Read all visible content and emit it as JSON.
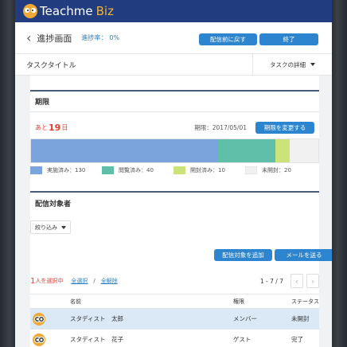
{
  "header": {
    "logo_main": "Teachme",
    "logo_biz": "Biz"
  },
  "topbar": {
    "back_icon": "chevron-left-icon",
    "title": "進捗画面",
    "progress_label": "進捗率：",
    "progress_value": "0%",
    "return_button": "配信前に戻す",
    "finish_button": "終了"
  },
  "task": {
    "title": "タスクタイトル",
    "detail_label": "タスクの詳細"
  },
  "deadline": {
    "heading": "期限",
    "remaining_prefix": "あと",
    "remaining_days": "19",
    "remaining_suffix": "日",
    "due_date": "期限：2017/05/01",
    "change_button": "期限を変更する",
    "chart_data": {
      "type": "bar",
      "orientation": "horizontal-stacked",
      "categories": [
        "実施済み",
        "閲覧済み",
        "開封済み",
        "未開封"
      ],
      "values": [
        130,
        40,
        10,
        20
      ],
      "colors": [
        "#7ba4dc",
        "#5fbfa9",
        "#cce37a",
        "#f1f1f1"
      ]
    },
    "legend": [
      {
        "label": "実施済み：130",
        "color": "#7ba4dc"
      },
      {
        "label": "閲覧済み：40",
        "color": "#5fbfa9"
      },
      {
        "label": "開封済み：10",
        "color": "#cce37a"
      },
      {
        "label": "未開封：20",
        "color": "#f1f1f1"
      }
    ]
  },
  "targets": {
    "heading": "配信対象者",
    "filter_label": "絞り込み",
    "add_button": "配信対象を追加",
    "mail_button": "メールを送る",
    "selected_count": "1",
    "selected_text": "人を選択中",
    "select_all": "全選択",
    "clear_all": "全解除",
    "pagination": "1 - 7 / 7",
    "columns": {
      "name": "名前",
      "role": "権限",
      "status": "ステータス"
    },
    "rows": [
      {
        "name": "スタディスト　太郎",
        "role": "メンバー",
        "status": "未開封"
      },
      {
        "name": "スタディスト　花子",
        "role": "ゲスト",
        "status": "完了"
      }
    ]
  }
}
